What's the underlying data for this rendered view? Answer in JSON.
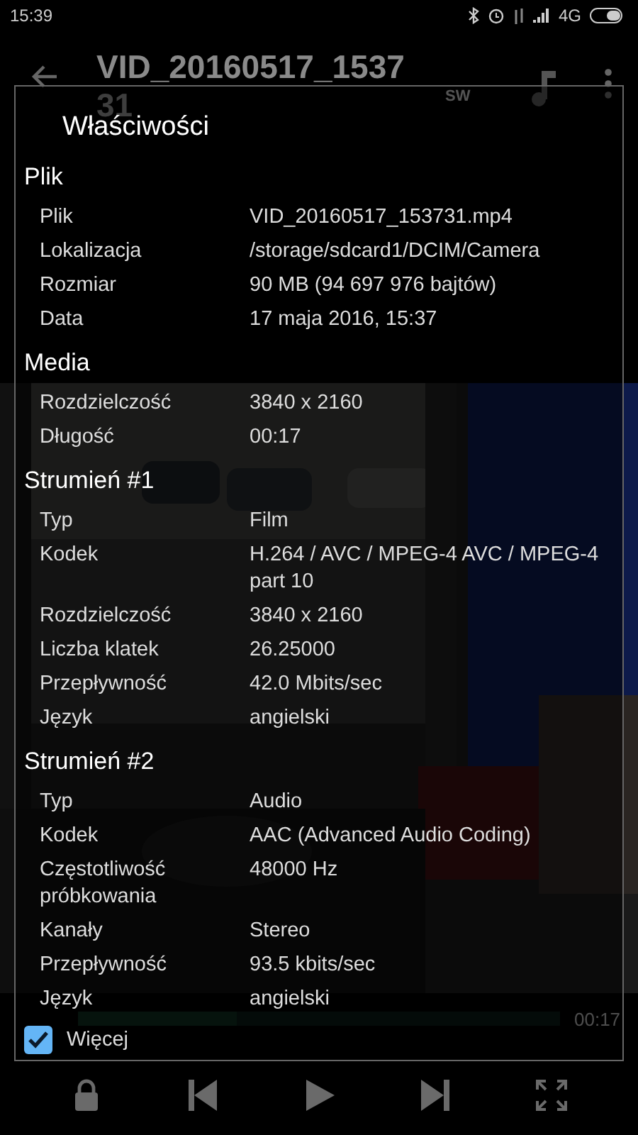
{
  "status_bar": {
    "time": "15:39",
    "network": "4G"
  },
  "toolbar": {
    "title": "VID_20160517_153731",
    "badge": "SW"
  },
  "player": {
    "duration": "00:17"
  },
  "dialog": {
    "title": "Właściwości",
    "sections": [
      {
        "title": "Plik",
        "rows": [
          {
            "label": "Plik",
            "value": "VID_20160517_153731.mp4"
          },
          {
            "label": "Lokalizacja",
            "value": "/storage/sdcard1/DCIM/Camera"
          },
          {
            "label": "Rozmiar",
            "value": "90 MB (94 697 976 bajtów)"
          },
          {
            "label": "Data",
            "value": "17 maja 2016, 15:37"
          }
        ]
      },
      {
        "title": "Media",
        "rows": [
          {
            "label": "Rozdzielczość",
            "value": "3840 x 2160"
          },
          {
            "label": "Długość",
            "value": "00:17"
          }
        ]
      },
      {
        "title": "Strumień #1",
        "rows": [
          {
            "label": "Typ",
            "value": "Film"
          },
          {
            "label": "Kodek",
            "value": "H.264 / AVC / MPEG-4 AVC / MPEG-4 part 10"
          },
          {
            "label": "Rozdzielczość",
            "value": "3840 x 2160"
          },
          {
            "label": "Liczba klatek",
            "value": "26.25000"
          },
          {
            "label": "Przepływność",
            "value": "42.0 Mbits/sec"
          },
          {
            "label": "Język",
            "value": "angielski"
          }
        ]
      },
      {
        "title": "Strumień #2",
        "rows": [
          {
            "label": "Typ",
            "value": "Audio"
          },
          {
            "label": "Kodek",
            "value": "AAC (Advanced Audio Coding)"
          },
          {
            "label": "Częstotliwość próbkowania",
            "value": "48000 Hz"
          },
          {
            "label": "Kanały",
            "value": "Stereo"
          },
          {
            "label": "Przepływność",
            "value": "93.5 kbits/sec"
          },
          {
            "label": "Język",
            "value": "angielski"
          }
        ]
      }
    ],
    "checkbox": {
      "label": "Więcej",
      "checked": true
    }
  }
}
